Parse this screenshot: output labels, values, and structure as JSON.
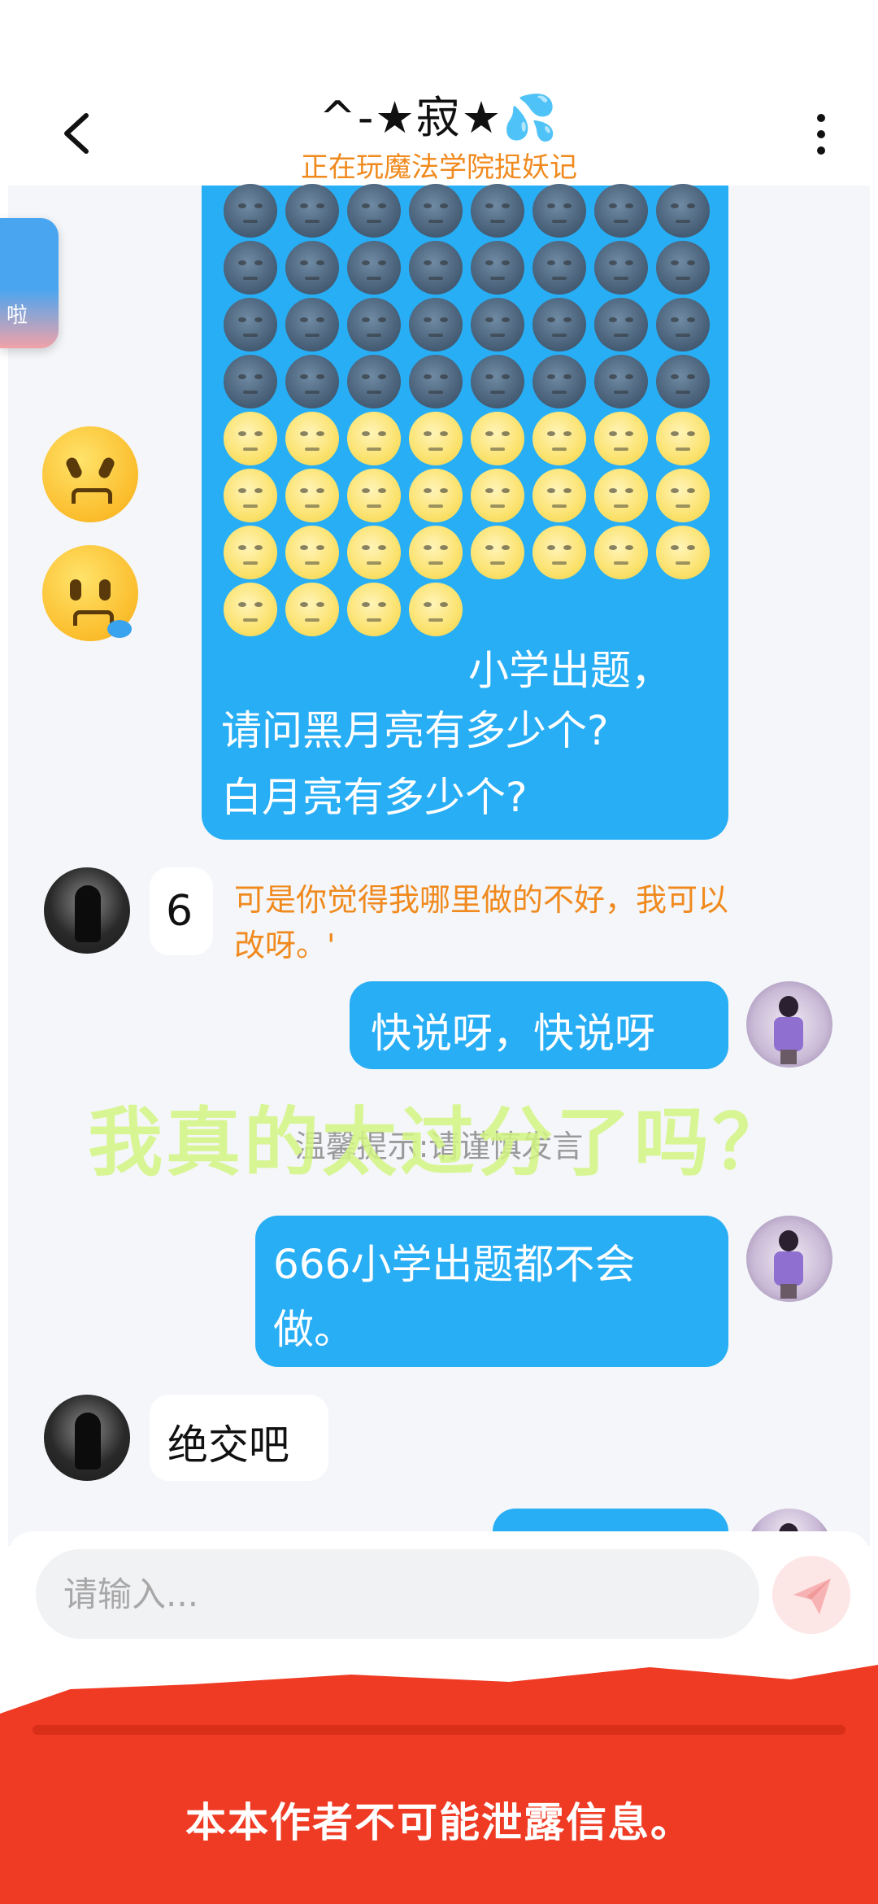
{
  "header": {
    "title": "^-★寂★💦",
    "status": "正在玩魔法学院捉妖记"
  },
  "floating_app": {
    "label": "啦"
  },
  "messages": {
    "emoji_bubble": {
      "dark_moon_count": 32,
      "light_moon_count": 28,
      "text_line1": "小学出题，",
      "text_line2": "请问黑月亮有多少个?",
      "text_line3": "白月亮有多少个?"
    },
    "reply_badge": "6",
    "reply_text_line1": "可是你觉得我哪里做的不好，我可以",
    "reply_text_line2": "改呀。'",
    "out_1": "快说呀，快说呀",
    "out_2_line1": "666小学出题都不会",
    "out_2_line2": "做。",
    "in_2": "绝交吧"
  },
  "overlay": {
    "caption": "我真的太过分了吗？",
    "system_tip": "温馨提示:请谨慎发言"
  },
  "input": {
    "placeholder": "请输入..."
  },
  "redaction": {
    "text": "本本作者不可能泄露信息。"
  },
  "colors": {
    "bubble_out": "#28aef5",
    "status_orange": "#f08a1e",
    "redaction_red": "#ef3b24",
    "caption_green": "#d2f582"
  }
}
